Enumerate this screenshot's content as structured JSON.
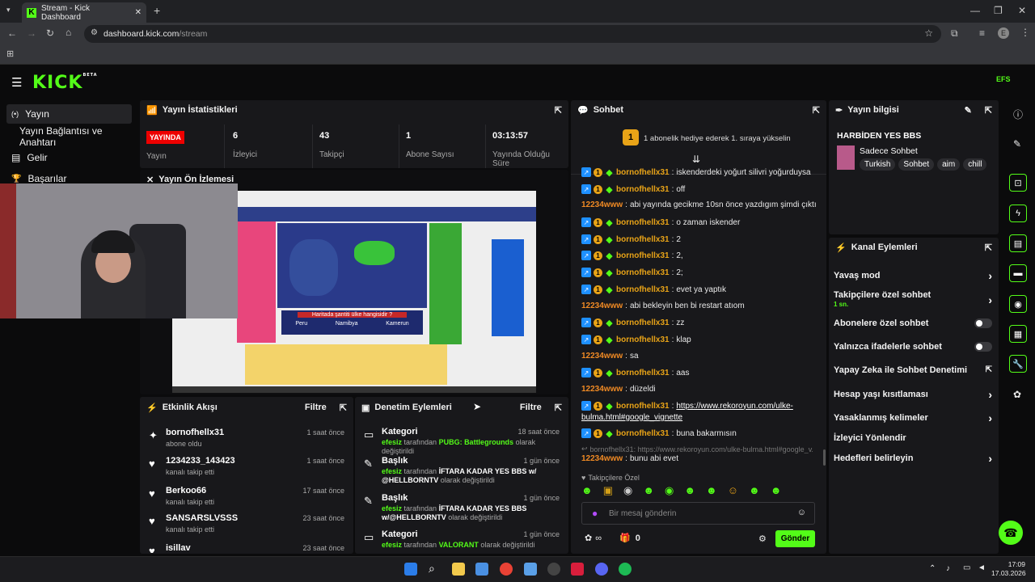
{
  "browser": {
    "tab_title": "Stream - Kick Dashboard",
    "url_domain": "dashboard.kick.com",
    "url_path": "/stream",
    "profile_initial": "E"
  },
  "header": {
    "logo": "KICK",
    "beta": "BETA"
  },
  "sidebar": {
    "items": [
      {
        "icon": "(•)",
        "label": "Yayın"
      },
      {
        "label": "Yayın Bağlantısı ve Anahtarı"
      },
      {
        "icon": "▤",
        "label": "Gelir"
      },
      {
        "icon": "🏆",
        "label": "Başarılar"
      }
    ]
  },
  "stats": {
    "title": "Yayın İstatistikleri",
    "live_badge": "YAYINDA",
    "live_label": "Yayın",
    "cells": [
      {
        "value": "6",
        "label": "İzleyici"
      },
      {
        "value": "43",
        "label": "Takipçi"
      },
      {
        "value": "1",
        "label": "Abone Sayısı"
      },
      {
        "value": "03:13:57",
        "label": "Yayında Olduğu Süre"
      }
    ]
  },
  "preview": {
    "title": "Yayın Ön İzlemesi",
    "site_question": "Haritada şantiti ülke hangisidir ?",
    "site_options": [
      "Peru",
      "Namibya",
      "Kamerun"
    ]
  },
  "activity": {
    "title": "Etkinlik Akışı",
    "filter": "Filtre",
    "items": [
      {
        "name": "bornofhellx31",
        "sub": "abone oldu",
        "time": "1 saat önce",
        "icon": "✦"
      },
      {
        "name": "1234233_143423",
        "sub": "kanalı takip etti",
        "time": "1 saat önce",
        "icon": "♥"
      },
      {
        "name": "Berkoo66",
        "sub": "kanalı takip etti",
        "time": "17 saat önce",
        "icon": "♥"
      },
      {
        "name": "SANSARSLVSSS",
        "sub": "kanalı takip etti",
        "time": "23 saat önce",
        "icon": "♥"
      },
      {
        "name": "isillav",
        "sub": "",
        "time": "23 saat önce",
        "icon": "♥"
      }
    ]
  },
  "moderation": {
    "title": "Denetim Eylemleri",
    "filter": "Filtre",
    "items": [
      {
        "type": "Kategori",
        "time": "18 saat önce",
        "user": "efesiz",
        "mid": " tarafından ",
        "value": "PUBG: Battlegrounds",
        "end": " olarak değiştirildi",
        "icon": "▭"
      },
      {
        "type": "Başlık",
        "time": "1 gün önce",
        "user": "efesiz",
        "mid": " tarafından ",
        "value": "İFTARA KADAR YES BBS w/ @HELLBORNTV",
        "end": " olarak değiştirildi",
        "icon": "✎"
      },
      {
        "type": "Başlık",
        "time": "1 gün önce",
        "user": "efesiz",
        "mid": " tarafından ",
        "value": "İFTARA KADAR YES BBS w/@HELLBORNTV",
        "end": " olarak değiştirildi",
        "icon": "✎"
      },
      {
        "type": "Kategori",
        "time": "1 gün önce",
        "user": "efesiz",
        "mid": " tarafından ",
        "value": "VALORANT",
        "end": " olarak değiştirildi",
        "icon": "▭"
      }
    ]
  },
  "chat": {
    "title": "Sohbet",
    "pinned": "1 abonelik hediye ederek 1. sıraya yükselin",
    "pinned_badge": "1",
    "messages": [
      {
        "badges": true,
        "user": "bornofhellx31",
        "text": "iskenderdeki yoğurt silivri yoğurduysa"
      },
      {
        "badges": true,
        "user": "bornofhellx31",
        "text": "off"
      },
      {
        "badges": false,
        "user": "12234www",
        "text": "abi yayında gecikme 10sn önce yazdıgım şimdi çıktı"
      },
      {
        "badges": true,
        "user": "bornofhellx31",
        "text": "o zaman iskender"
      },
      {
        "badges": true,
        "user": "bornofhellx31",
        "text": "2"
      },
      {
        "badges": true,
        "user": "bornofhellx31",
        "text": "2,"
      },
      {
        "badges": true,
        "user": "bornofhellx31",
        "text": "2;"
      },
      {
        "badges": true,
        "user": "bornofhellx31",
        "text": "evet ya yaptık"
      },
      {
        "badges": false,
        "user": "12234www",
        "text": "abi bekleyin ben bi restart atıom"
      },
      {
        "badges": true,
        "user": "bornofhellx31",
        "text": "zz"
      },
      {
        "badges": true,
        "user": "bornofhellx31",
        "text": "klap"
      },
      {
        "badges": false,
        "user": "12234www",
        "text": "sa"
      },
      {
        "badges": true,
        "user": "bornofhellx31",
        "text": "aas"
      },
      {
        "badges": false,
        "user": "12234www",
        "text": "düzeldi"
      }
    ],
    "link_msg": {
      "user": "bornofhellx31",
      "link1": "https://www.rekoroyun.com/ulke-",
      "link2": "bulma.html#google_vignette"
    },
    "last_msg": {
      "user": "bornofhellx31",
      "text": "buna bakarmısın"
    },
    "reply_ref": "bornofhellx31: https://www.rekoroyun.com/ulke-bulma.html#google_v...",
    "reply_msg": {
      "user": "12234www",
      "text": "bunu abi evet"
    },
    "followers_only": "Takipçilere Özel",
    "input_placeholder": "Bir mesaj gönderin",
    "points": "∞",
    "gifts": "0",
    "send": "Gönder"
  },
  "stream_info": {
    "title": "Yayın bilgisi",
    "stream_title": "HARBİDEN YES BBS",
    "category": "Sadece Sohbet",
    "tags": [
      "Turkish",
      "Sohbet",
      "aim",
      "chill"
    ]
  },
  "channel_actions": {
    "title": "Kanal Eylemleri",
    "items": [
      {
        "label": "Yavaş mod",
        "control": "chevron"
      },
      {
        "label": "Takipçilere özel sohbet",
        "sub": "1 sn.",
        "control": "chevron"
      },
      {
        "label": "Abonelere özel sohbet",
        "control": "toggle"
      },
      {
        "label": "Yalnızca ifadelerle sohbet",
        "control": "toggle"
      },
      {
        "label": "Yapay Zeka ile Sohbet Denetimi",
        "control": "external"
      },
      {
        "label": "Hesap yaşı kısıtlaması",
        "control": "chevron"
      },
      {
        "label": "Yasaklanmış kelimeler",
        "control": "chevron"
      },
      {
        "label": "İzleyici Yönlendir",
        "control": "none"
      },
      {
        "label": "Hedefleri belirleyin",
        "control": "chevron"
      }
    ]
  },
  "taskbar": {
    "time": "17:09",
    "date": "17.03.2026"
  },
  "colors": {
    "accent": "#53fc18",
    "panel": "#18181b",
    "live": "#ee0000",
    "username": "#e8a317"
  }
}
